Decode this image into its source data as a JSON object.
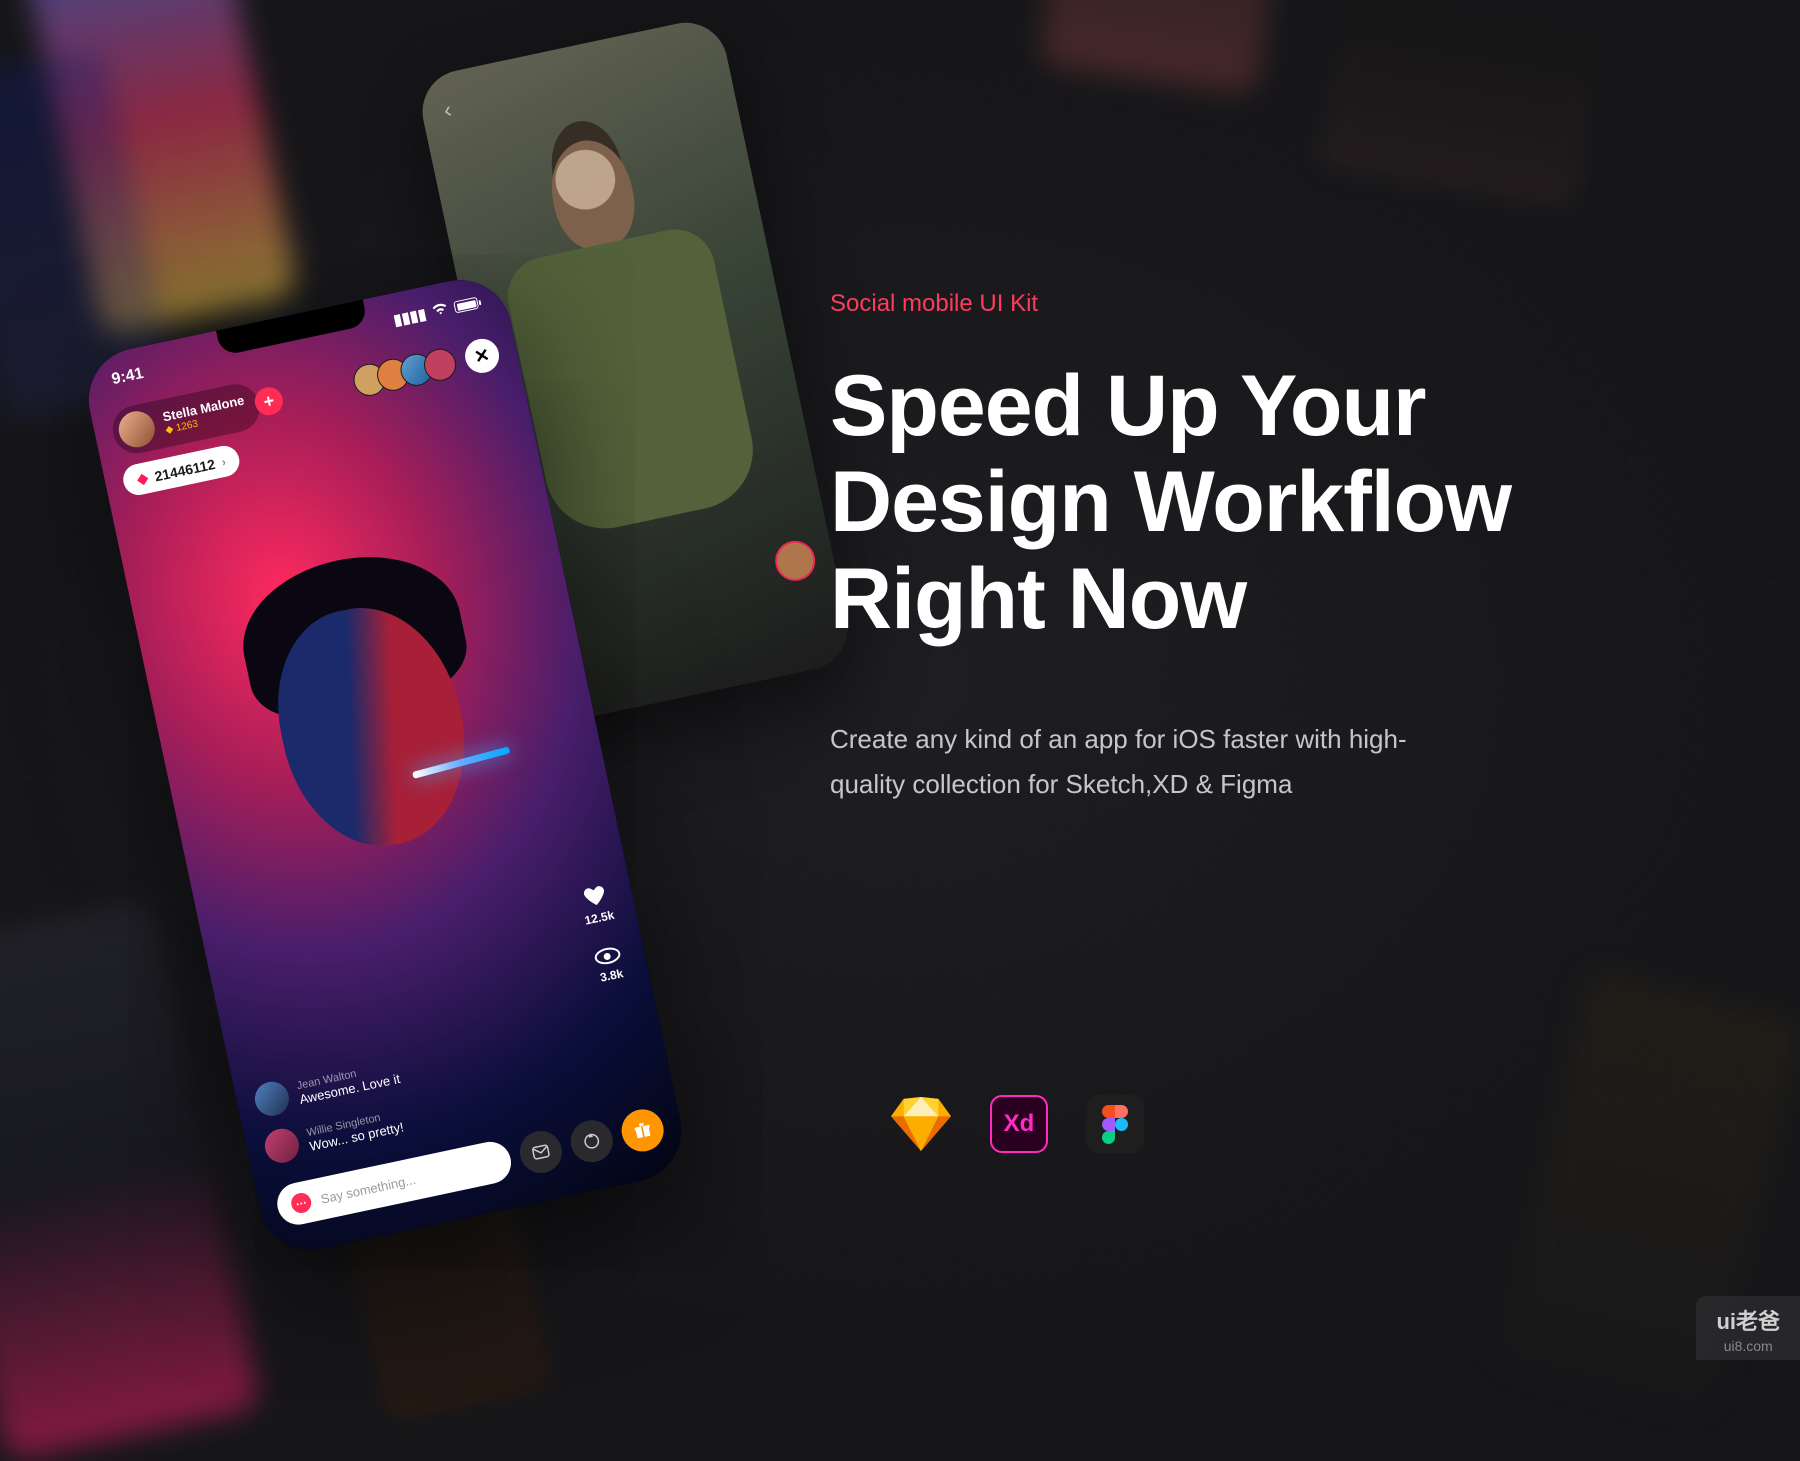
{
  "marketing": {
    "eyebrow": "Social mobile UI Kit",
    "headline": "Speed Up Your Design Workflow Right Now",
    "subhead": "Create any kind of an app for iOS faster with high-quality collection for Sketch,XD & Figma"
  },
  "tools": {
    "sketch": "Sketch",
    "xd_label": "Xd",
    "figma": "Figma"
  },
  "phone_main": {
    "time": "9:41",
    "host": {
      "name": "Stella Malone",
      "gems": "1263"
    },
    "gem_count": "21446112",
    "likes": "12.5k",
    "views": "3.8k",
    "comments": [
      {
        "name": "Jean Walton",
        "text": "Awesome. Love it"
      },
      {
        "name": "Willie Singleton",
        "text": "Wow... so pretty!"
      }
    ],
    "input_placeholder": "Say something..."
  },
  "watermark": {
    "line1": "ui老爸",
    "line2": "ui8.com"
  }
}
